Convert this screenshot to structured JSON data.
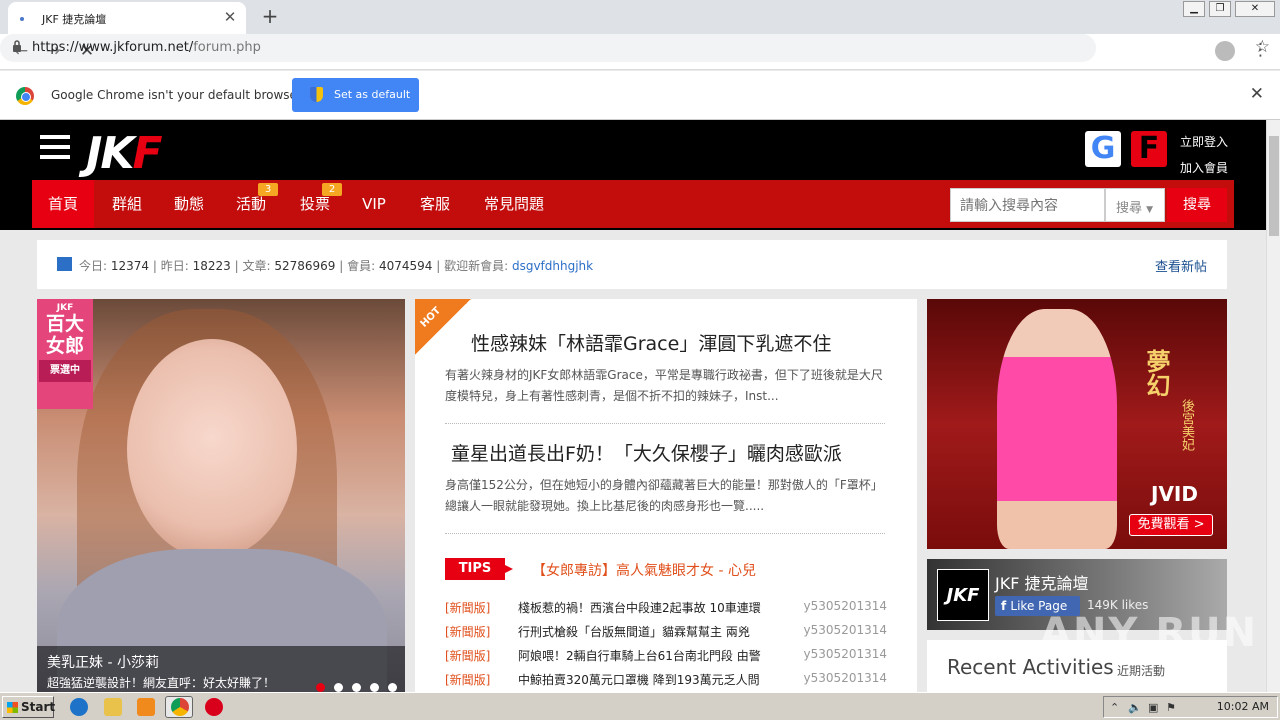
{
  "browser": {
    "tab_title": "JKF 捷克論壇",
    "url_host": "https://www.jkforum.net/",
    "url_path": "forum.php",
    "infobar_message": "Google Chrome isn't your default browser",
    "set_default_label": "Set as default"
  },
  "site": {
    "logo_main": "JK",
    "logo_accent": "F",
    "google_letter": "G",
    "facebook_letter": "F",
    "login": "立即登入",
    "register": "加入會員",
    "nav": [
      {
        "label": "首頁"
      },
      {
        "label": "群組"
      },
      {
        "label": "動態"
      },
      {
        "label": "活動",
        "badge": "3"
      },
      {
        "label": "投票",
        "badge": "2"
      },
      {
        "label": "VIP"
      },
      {
        "label": "客服"
      },
      {
        "label": "常見問題"
      }
    ],
    "search_placeholder": "請輸入搜尋內容",
    "search_select": "搜尋",
    "search_button": "搜尋"
  },
  "stats": {
    "today_label": "今日:",
    "today": "12374",
    "yesterday_label": "昨日:",
    "yesterday": "18223",
    "posts_label": "文章:",
    "posts": "52786969",
    "members_label": "會員:",
    "members": "4074594",
    "welcome_label": "歡迎新會員:",
    "new_member": "dsgvfdhhgjhk",
    "new_posts": "查看新帖"
  },
  "promo": {
    "tag_top": "JKF",
    "tag_main": "百大女郎",
    "tag_sub": "票選中",
    "caption_title": "美乳正妹 - 小莎莉",
    "caption_sub": "超強猛逆襲設計！網友直呼：好太好賺了！"
  },
  "articles": [
    {
      "title": "性感辣妹「林語霏Grace」渾圓下乳遮不住",
      "desc": "有著火辣身材的JKF女郎林語霏Grace，平常是專職行政祕書，但下了班後就是大尺度模特兒，身上有著性感刺青，是個不折不扣的辣妹子，Inst..."
    },
    {
      "title": "童星出道長出F奶！「大久保櫻子」曬肉感歐派",
      "desc": "身高僅152公分，但在她短小的身體內卻蘊藏著巨大的能量！那對傲人的「F罩杯」總讓人一眼就能發現她。換上比基尼後的肉感身形也一覽....."
    }
  ],
  "hot_label": "HOT",
  "tips": {
    "label": "TIPS",
    "link": "【女郎專訪】高人氣魅眼才女 - 心兒"
  },
  "news": [
    {
      "cat": "[新聞版]",
      "title": "棧板惹的禍！西濱台中段連2起事故 10車連環",
      "author": "y5305201314"
    },
    {
      "cat": "[新聞版]",
      "title": "行刑式槍殺「台版無間道」貓霖幫幫主 兩兇",
      "author": "y5305201314"
    },
    {
      "cat": "[新聞版]",
      "title": "阿娘喂！2輛自行車騎上台61台南北門段 由警",
      "author": "y5305201314"
    },
    {
      "cat": "[新聞版]",
      "title": "中鯨拍賣320萬元口罩機 降到193萬元乏人問",
      "author": "y5305201314"
    }
  ],
  "ad": {
    "kanji": "夢幻",
    "kanji_sub": "後宮美妃",
    "brand": "JVID",
    "watch": "免費觀看 >"
  },
  "fb": {
    "logo": "JKF",
    "name": "JKF 捷克論壇",
    "like": "Like Page",
    "likes": "149K likes"
  },
  "recent": {
    "title": "Recent Activities",
    "sub": "近期活動"
  },
  "watermark": "ANY RUN",
  "taskbar": {
    "start": "Start",
    "clock": "10:02 AM"
  }
}
